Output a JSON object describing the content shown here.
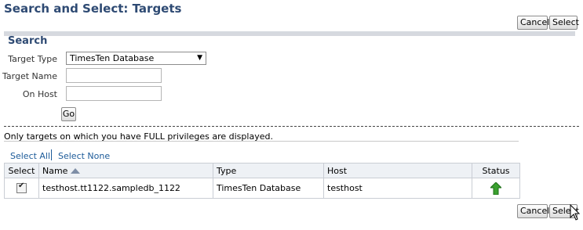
{
  "header": {
    "title": "Search and Select: Targets"
  },
  "top_actions": {
    "cancel_label": "Cancel",
    "select_label": "Select"
  },
  "search": {
    "title": "Search",
    "target_type_label": "Target Type",
    "target_type_value": "TimesTen Database",
    "target_name_label": "Target Name",
    "target_name_value": "",
    "on_host_label": "On Host",
    "on_host_value": "",
    "go_label": "Go"
  },
  "info_text": "Only targets on which you have FULL privileges are displayed.",
  "selection_links": {
    "select_all": "Select All",
    "select_none": "Select None"
  },
  "table": {
    "columns": [
      "Select",
      "Name",
      "Type",
      "Host",
      "Status"
    ],
    "sorted_column": "Name",
    "sort_direction": "ascending",
    "rows": [
      {
        "selected": true,
        "name": "testhost.tt1122.sampledb_1122",
        "type": "TimesTen Database",
        "host": "testhost",
        "status": "up-arrow-icon"
      }
    ]
  },
  "bottom_actions": {
    "cancel_label": "Cancel",
    "select_label": "Select"
  },
  "colors": {
    "title": "#2e4a73",
    "link": "#1d5b99",
    "status_up": "#3aa02f",
    "header_bg": "#eef1f5"
  }
}
